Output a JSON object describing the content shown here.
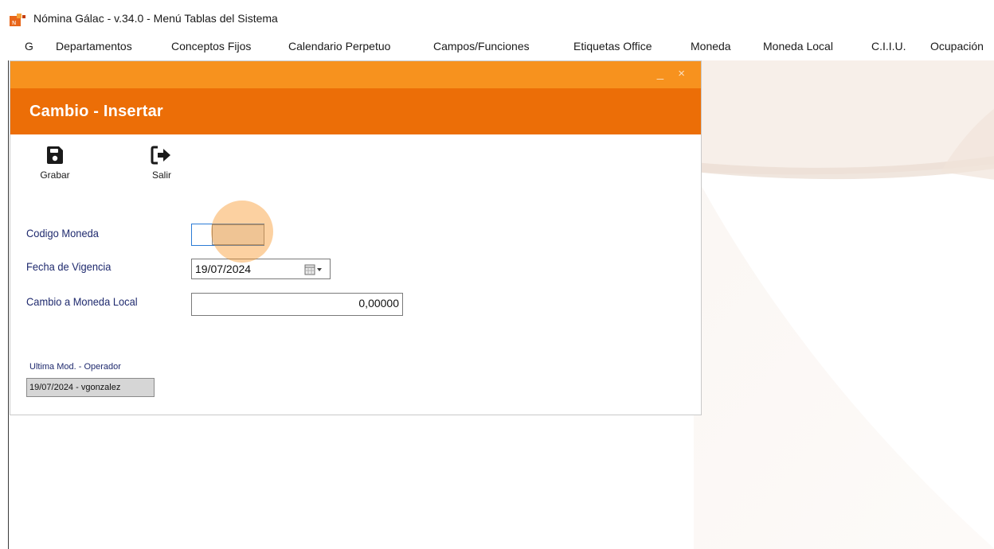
{
  "window": {
    "title": "Nómina Gálac  - v.34.0 - Menú Tablas del Sistema",
    "icon": "galac-app-icon"
  },
  "menu": {
    "items": [
      {
        "label": "G"
      },
      {
        "label": "Departamentos"
      },
      {
        "label": "Conceptos Fijos"
      },
      {
        "label": "Calendario Perpetuo"
      },
      {
        "label": "Campos/Funciones"
      },
      {
        "label": "Etiquetas Office"
      },
      {
        "label": "Moneda"
      },
      {
        "label": "Moneda Local"
      },
      {
        "label": "C.I.I.U."
      },
      {
        "label": "Ocupación"
      }
    ]
  },
  "dialog": {
    "title": "Cambio - Insertar",
    "controls": {
      "minimize": "_",
      "close": "×"
    },
    "toolbar": {
      "save_label": "Grabar",
      "save_icon": "floppy-disk-icon",
      "exit_label": "Salir",
      "exit_icon": "sign-out-icon"
    },
    "form": {
      "codigo_moneda_label": "Codigo Moneda",
      "codigo_moneda_value": "",
      "fecha_vigencia_label": "Fecha de Vigencia",
      "fecha_vigencia_value": "19/07/2024",
      "cambio_label": "Cambio a Moneda Local",
      "cambio_value": "0,00000"
    },
    "footer": {
      "mod_label": "Ultima Mod. - Operador",
      "mod_value": "19/07/2024 - vgonzalez"
    }
  },
  "colors": {
    "header_orange": "#ec6e07",
    "topbar_orange": "#f7921e",
    "label_navy": "#1f2a6e",
    "focus_blue": "#2b7bd6",
    "click_highlight": "#f7921e"
  }
}
